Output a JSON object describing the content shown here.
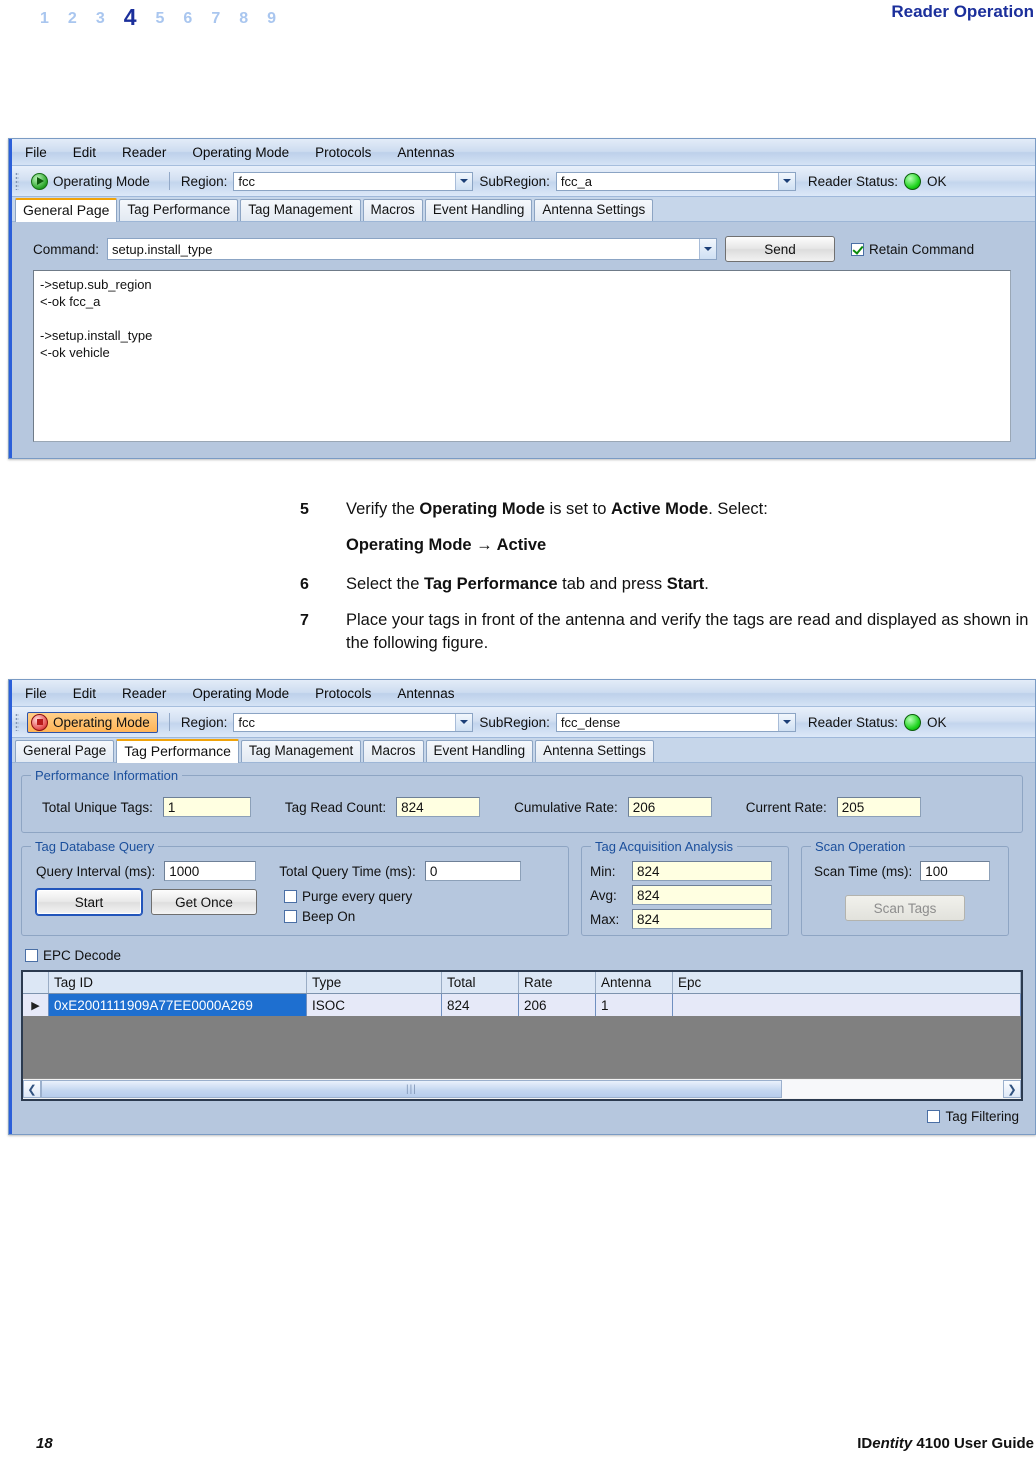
{
  "header": {
    "chapter_numbers": [
      "1",
      "2",
      "3",
      "4",
      "5",
      "6",
      "7",
      "8",
      "9"
    ],
    "current_chapter": "4",
    "title": "Reader Operation"
  },
  "colors": {
    "accent_blue": "#1b2f9b",
    "dialog_face": "#b6c7de",
    "selected_row": "#1e6fd0",
    "tab_highlight": "#f0a30a",
    "status_ok": "#19d219",
    "field_yellow": "#ffffe1"
  },
  "dialog1": {
    "menu": [
      "File",
      "Edit",
      "Reader",
      "Operating Mode",
      "Protocols",
      "Antennas"
    ],
    "toolbar": {
      "operating_mode_label": "Operating Mode",
      "operating_mode_icon": "play-icon",
      "region_label": "Region:",
      "region_value": "fcc",
      "subregion_label": "SubRegion:",
      "subregion_value": "fcc_a",
      "reader_status_label": "Reader Status:",
      "reader_status_value": "OK"
    },
    "tabs": [
      {
        "label": "General Page",
        "selected": true
      },
      {
        "label": "Tag Performance",
        "selected": false
      },
      {
        "label": "Tag Management",
        "selected": false
      },
      {
        "label": "Macros",
        "selected": false
      },
      {
        "label": "Event Handling",
        "selected": false
      },
      {
        "label": "Antenna Settings",
        "selected": false
      }
    ],
    "general_page": {
      "command_label": "Command:",
      "command_value": "setup.install_type",
      "send_label": "Send",
      "retain_label": "Retain Command",
      "retain_checked": true,
      "log": "->setup.sub_region\n<-ok fcc_a\n\n->setup.install_type\n<-ok vehicle"
    }
  },
  "steps": [
    {
      "num": "5",
      "text_parts": [
        {
          "t": "Verify the ",
          "b": false
        },
        {
          "t": "Operating Mode",
          "b": true
        },
        {
          "t": " is set to ",
          "b": false
        },
        {
          "t": "Active Mode",
          "b": true
        },
        {
          "t": ". Select:",
          "b": false
        }
      ],
      "substep": "Operating Mode → Active"
    },
    {
      "num": "6",
      "text_parts": [
        {
          "t": "Select the ",
          "b": false
        },
        {
          "t": "Tag Performance",
          "b": true
        },
        {
          "t": " tab and press ",
          "b": false
        },
        {
          "t": "Start",
          "b": true
        },
        {
          "t": ".",
          "b": false
        }
      ]
    },
    {
      "num": "7",
      "text_parts": [
        {
          "t": "Place your tags in front of the antenna and verify the tags are read and displayed as shown in the following figure.",
          "b": false
        }
      ]
    }
  ],
  "dialog2": {
    "menu": [
      "File",
      "Edit",
      "Reader",
      "Operating Mode",
      "Protocols",
      "Antennas"
    ],
    "toolbar": {
      "operating_mode_label": "Operating Mode",
      "operating_mode_icon": "stop-icon",
      "operating_mode_active": true,
      "region_label": "Region:",
      "region_value": "fcc",
      "subregion_label": "SubRegion:",
      "subregion_value": "fcc_dense",
      "reader_status_label": "Reader Status:",
      "reader_status_value": "OK"
    },
    "tabs": [
      {
        "label": "General Page",
        "selected": false
      },
      {
        "label": "Tag Performance",
        "selected": true
      },
      {
        "label": "Tag Management",
        "selected": false
      },
      {
        "label": "Macros",
        "selected": false
      },
      {
        "label": "Event Handling",
        "selected": false
      },
      {
        "label": "Antenna Settings",
        "selected": false
      }
    ],
    "performance_information": {
      "legend": "Performance Information",
      "total_unique_tags_label": "Total Unique Tags:",
      "total_unique_tags_value": "1",
      "tag_read_count_label": "Tag Read Count:",
      "tag_read_count_value": "824",
      "cumulative_rate_label": "Cumulative Rate:",
      "cumulative_rate_value": "206",
      "current_rate_label": "Current Rate:",
      "current_rate_value": "205"
    },
    "tag_database_query": {
      "legend": "Tag Database Query",
      "query_interval_label": "Query Interval (ms):",
      "query_interval_value": "1000",
      "total_query_time_label": "Total Query Time (ms):",
      "total_query_time_value": "0",
      "start_label": "Start",
      "get_once_label": "Get Once",
      "purge_label": "Purge every query",
      "purge_checked": false,
      "beep_label": "Beep On",
      "beep_checked": false
    },
    "tag_acquisition_analysis": {
      "legend": "Tag Acquisition Analysis",
      "min_label": "Min:",
      "min_value": "824",
      "avg_label": "Avg:",
      "avg_value": "824",
      "max_label": "Max:",
      "max_value": "824"
    },
    "scan_operation": {
      "legend": "Scan Operation",
      "scan_time_label": "Scan Time (ms):",
      "scan_time_value": "100",
      "scan_tags_label": "Scan Tags",
      "scan_tags_disabled": true
    },
    "epc_decode_label": "EPC Decode",
    "epc_decode_checked": false,
    "grid": {
      "columns": [
        "Tag ID",
        "Type",
        "Total",
        "Rate",
        "Antenna",
        "Epc"
      ],
      "rows": [
        {
          "marker": "▶",
          "selected": true,
          "cells": [
            "0xE2001111909A77EE0000A269",
            "ISOC",
            "824",
            "206",
            "1",
            ""
          ]
        }
      ]
    },
    "tag_filtering_label": "Tag Filtering",
    "tag_filtering_checked": false
  },
  "footer": {
    "page_number": "18",
    "guide_prefix": "ID",
    "guide_italic": "entity",
    "guide_suffix": " 4100 User Guide"
  }
}
